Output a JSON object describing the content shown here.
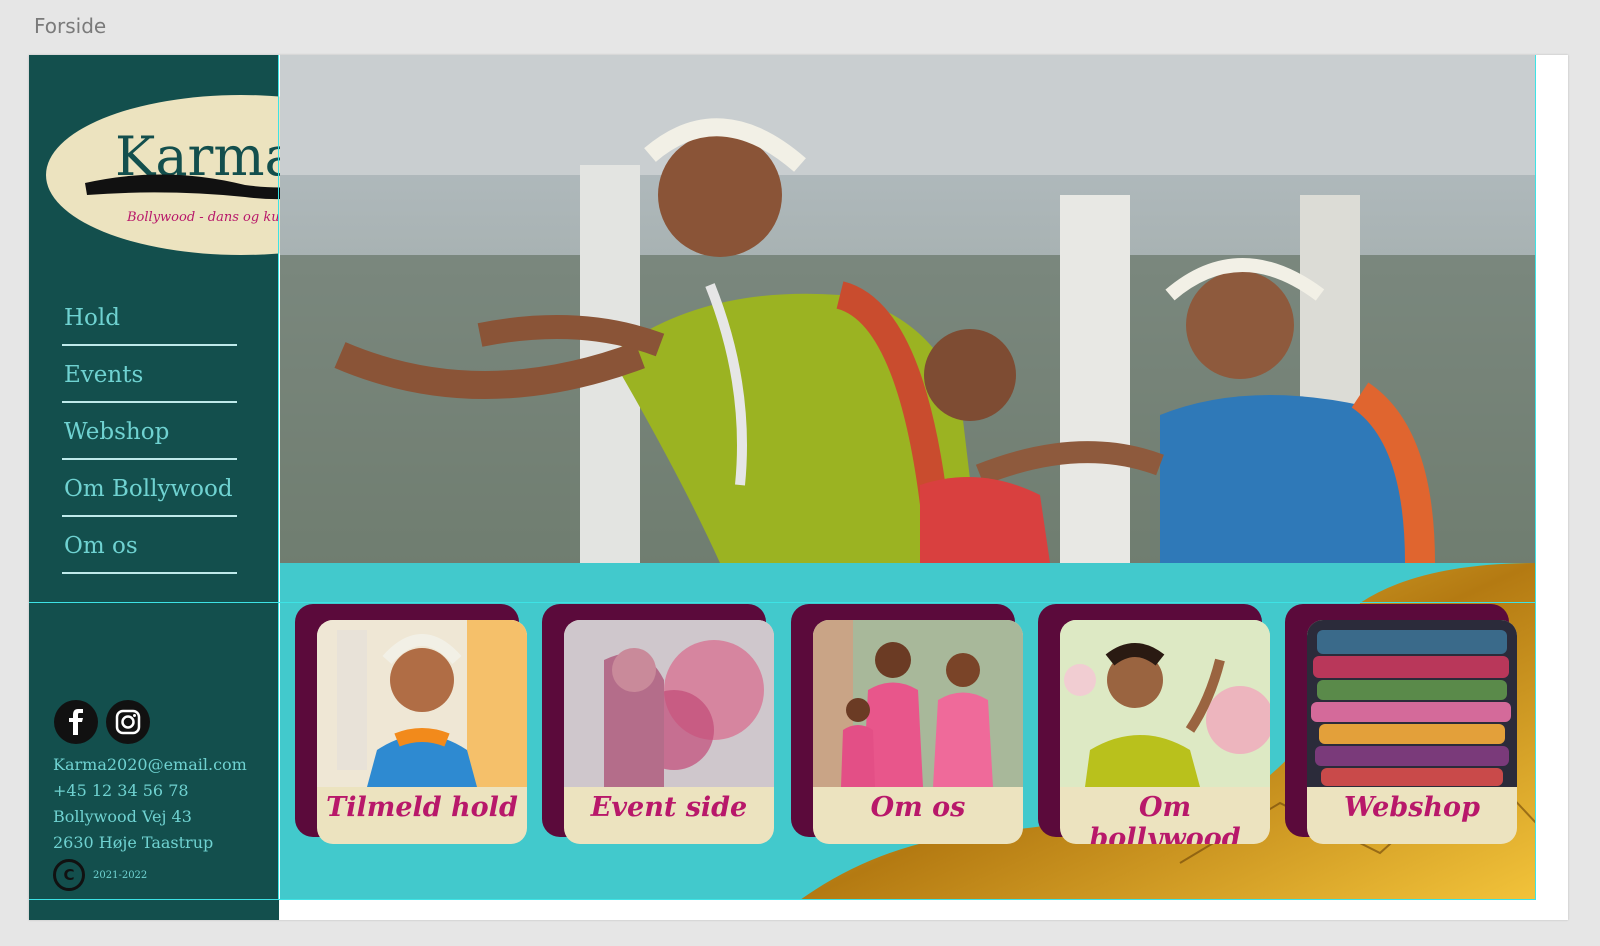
{
  "artboard": {
    "title": "Forside"
  },
  "brand": {
    "name": "Karma",
    "tagline": "Bollywood - dans og kultur"
  },
  "nav": {
    "items": [
      {
        "label": "Hold"
      },
      {
        "label": "Events"
      },
      {
        "label": "Webshop"
      },
      {
        "label": "Om Bollywood"
      },
      {
        "label": "Om os"
      }
    ]
  },
  "social": {
    "icons": [
      "facebook-icon",
      "instagram-icon"
    ]
  },
  "contact": {
    "email": "Karma2020@email.com",
    "phone": "+45 12 34 56 78",
    "street": "Bollywood Vej 43",
    "city": "2630 Høje Taastrup"
  },
  "footer": {
    "copyright_symbol": "C",
    "years": "2021-2022"
  },
  "cards": [
    {
      "label": "Tilmeld hold"
    },
    {
      "label": "Event side"
    },
    {
      "label": "Om os"
    },
    {
      "label": "Om bollywood"
    },
    {
      "label": "Webshop"
    }
  ],
  "colors": {
    "sidebar": "#134f4d",
    "accent_teal": "#42c9cc",
    "card_back": "#5b0a3b",
    "card_front": "#ece3bf",
    "card_text": "#b8186a",
    "nav_text": "#6fd2d1"
  }
}
